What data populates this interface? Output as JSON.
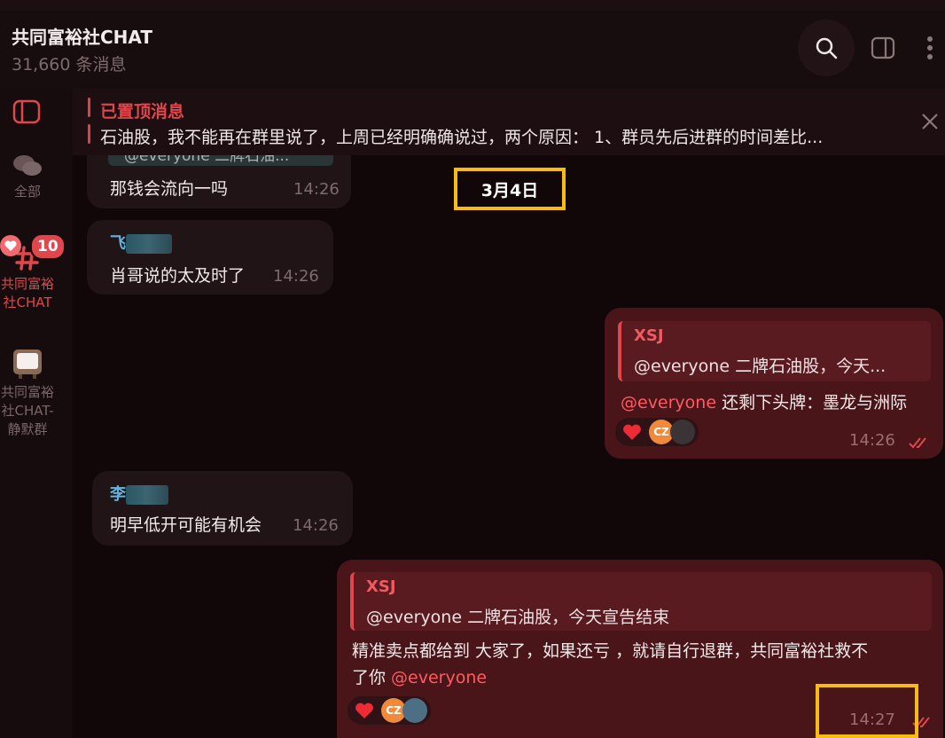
{
  "header": {
    "title": "共同富裕社CHAT",
    "subtitle": "31,660 条消息"
  },
  "sidebar": {
    "folders": [
      {
        "label": "全部"
      },
      {
        "label": "共同富裕社CHAT",
        "badge": "10"
      },
      {
        "label": "共同富裕社CHAT-静默群"
      }
    ]
  },
  "pinned": {
    "title": "已置顶消息",
    "text": "石油股，我不能再在群里说了，上周已经明确确说过，两个原因： 1、群员先后进群的时间差比..."
  },
  "date_separator": "3月4日",
  "messages": [
    {
      "partial_quote": "@everyone 二牌石油...",
      "text": "那钱会流向一吗",
      "time": "14:26"
    },
    {
      "sender": "飞",
      "text": "肖哥说的太及时了",
      "time": "14:26"
    },
    {
      "reply_name": "XSJ",
      "reply_text": "@everyone 二牌石油股，今天...",
      "mention": "@everyone",
      "text": " 还剩下头牌：墨龙与洲际",
      "time": "14:26",
      "reaction_avatar": "CZ"
    },
    {
      "sender": "李",
      "text": "明早低开可能有机会",
      "time": "14:26"
    },
    {
      "reply_name": "XSJ",
      "reply_text": "@everyone 二牌石油股，今天宣告结束",
      "text_line1": "精准卖点都给到 大家了，如果还亏 ，就请自行退群，共同富裕社救不",
      "text_line2": "了你 ",
      "mention": "@everyone",
      "time": "14:27",
      "reaction_avatar": "CZ"
    }
  ],
  "colors": {
    "accent": "#e0474c",
    "highlight": "#f6bb15",
    "outgoing": "#4a1519",
    "incoming": "#211416"
  }
}
